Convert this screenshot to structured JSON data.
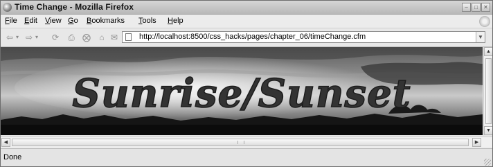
{
  "window": {
    "title": "Time Change - Mozilla Firefox"
  },
  "menu": [
    {
      "label": "File",
      "accel": "F",
      "rest": "ile"
    },
    {
      "label": "Edit",
      "accel": "E",
      "rest": "dit"
    },
    {
      "label": "View",
      "accel": "V",
      "rest": "iew"
    },
    {
      "label": "Go",
      "accel": "G",
      "rest": "o"
    },
    {
      "label": "Bookmarks",
      "accel": "B",
      "rest": "ookmarks"
    },
    {
      "label": "Tools",
      "accel": "T",
      "rest": "ools"
    },
    {
      "label": "Help",
      "accel": "H",
      "rest": "elp"
    }
  ],
  "toolbar": {
    "back_icon": "back-arrow-icon",
    "forward_icon": "forward-arrow-icon",
    "reload_icon": "reload-icon",
    "stop_icon": "stop-icon",
    "home_icon": "home-icon"
  },
  "address": {
    "url": "http://localhost:8500/css_hacks/pages/chapter_06/timeChange.cfm"
  },
  "content": {
    "banner_text": "Sunrise/Sunset"
  },
  "status": {
    "text": "Done"
  }
}
